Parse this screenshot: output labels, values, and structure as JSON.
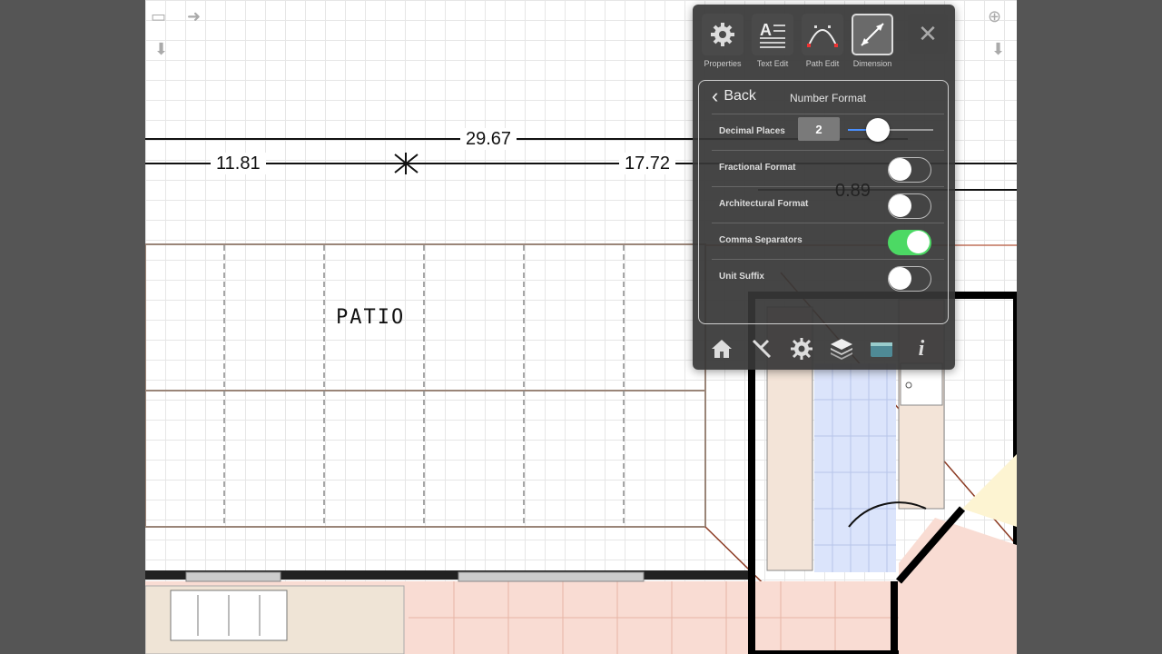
{
  "dimensions": {
    "overall": "29.67",
    "left": "11.81",
    "right": "17.72",
    "small": "0.89"
  },
  "room": {
    "label": "PATIO"
  },
  "panel": {
    "tabs": [
      {
        "label": "Properties",
        "icon": "gear-icon"
      },
      {
        "label": "Text Edit",
        "icon": "text-edit-icon"
      },
      {
        "label": "Path Edit",
        "icon": "path-edit-icon"
      },
      {
        "label": "Dimension",
        "icon": "dimension-icon",
        "selected": true
      }
    ],
    "close_label": "✕",
    "back_label": "Back",
    "title": "Number Format",
    "decimal_places": {
      "label": "Decimal Places",
      "value": "2",
      "level": 0.35
    },
    "options": [
      {
        "label": "Fractional Format",
        "on": false
      },
      {
        "label": "Architectural Format",
        "on": false
      },
      {
        "label": "Comma Separators",
        "on": true
      },
      {
        "label": "Unit Suffix",
        "on": false
      }
    ],
    "bottom_icons": [
      "home-icon",
      "tools-icon",
      "settings-icon",
      "layers-icon",
      "library-icon",
      "info-icon"
    ],
    "info_glyph": "i"
  },
  "colors": {
    "accent_on": "#4cd964",
    "wall": "#000000",
    "floor_tile": "#f9dcd3",
    "floor_blue": "#dbe4fb"
  }
}
